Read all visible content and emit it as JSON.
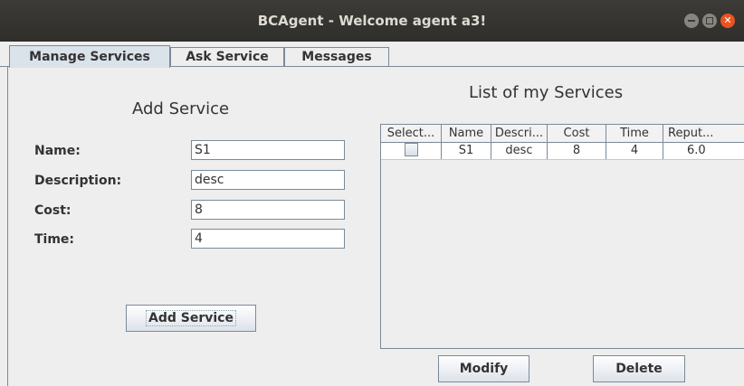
{
  "window": {
    "title": "BCAgent - Welcome agent a3!"
  },
  "tabs": [
    {
      "label": "Manage Services",
      "active": true
    },
    {
      "label": "Ask Service",
      "active": false
    },
    {
      "label": "Messages",
      "active": false
    }
  ],
  "add_service": {
    "heading": "Add Service",
    "fields": [
      {
        "label": "Name:",
        "value": "S1"
      },
      {
        "label": "Description:",
        "value": "desc"
      },
      {
        "label": "Cost:",
        "value": "8"
      },
      {
        "label": "Time:",
        "value": "4"
      }
    ],
    "button": "Add Service"
  },
  "services": {
    "heading": "List of my Services",
    "columns": [
      "Select...",
      "Name",
      "Descri...",
      "Cost",
      "Time",
      "Reput..."
    ],
    "rows": [
      {
        "selected": false,
        "name": "S1",
        "description": "desc",
        "cost": "8",
        "time": "4",
        "reputation": "6.0"
      }
    ],
    "modify_button": "Modify",
    "delete_button": "Delete"
  }
}
